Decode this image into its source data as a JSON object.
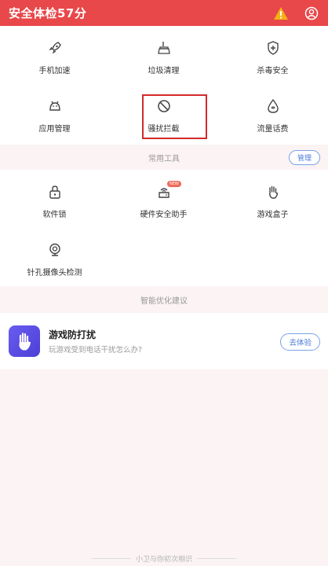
{
  "header": {
    "title": "安全体检57分",
    "warning_icon": "warning-icon",
    "user_icon": "user-icon"
  },
  "main_grid": [
    {
      "label": "手机加速",
      "icon": "rocket-icon"
    },
    {
      "label": "垃圾清理",
      "icon": "broom-icon"
    },
    {
      "label": "杀毒安全",
      "icon": "shield-icon"
    },
    {
      "label": "应用管理",
      "icon": "android-icon"
    },
    {
      "label": "骚扰拦截",
      "icon": "block-icon"
    },
    {
      "label": "流量话费",
      "icon": "drop-icon"
    }
  ],
  "tools_section": {
    "title": "常用工具",
    "manage_label": "管理",
    "items": [
      {
        "label": "软件锁",
        "icon": "lock-icon"
      },
      {
        "label": "硬件安全助手",
        "icon": "router-icon",
        "badge": "NEW"
      },
      {
        "label": "游戏盒子",
        "icon": "hand-icon"
      },
      {
        "label": "针孔摄像头检测",
        "icon": "camera-icon"
      }
    ]
  },
  "suggest_section": {
    "title": "智能优化建议",
    "card": {
      "title": "游戏防打扰",
      "subtitle": "玩游戏受到电话干扰怎么办?",
      "button": "去体验"
    }
  },
  "footer": {
    "text": "小卫与你初次相识"
  },
  "colors": {
    "header_bg": "#e8484a",
    "accent_blue": "#4a7bd9",
    "highlight_red": "#d32a2a",
    "page_bg": "#fbf3f4"
  }
}
